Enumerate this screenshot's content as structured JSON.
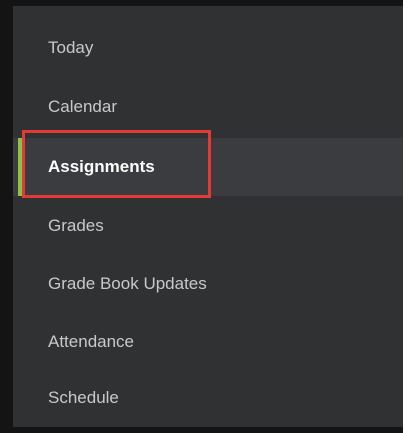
{
  "nav": {
    "items": [
      {
        "label": "Today"
      },
      {
        "label": "Calendar"
      },
      {
        "label": "Assignments",
        "active": true
      },
      {
        "label": "Grades"
      },
      {
        "label": "Grade Book Updates"
      },
      {
        "label": "Attendance"
      },
      {
        "label": "Schedule"
      }
    ]
  },
  "colors": {
    "background": "#2f3133",
    "active_background": "#3a3c3f",
    "active_indicator": "#8bc34a",
    "highlight_border": "#e53935",
    "text": "#c9c9c9",
    "active_text": "#ffffff"
  }
}
